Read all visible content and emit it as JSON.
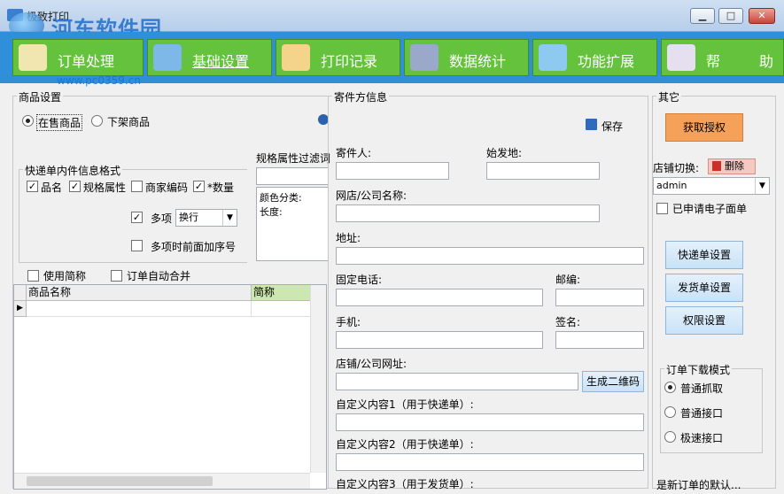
{
  "window": {
    "title": "极致打印"
  },
  "watermark": {
    "name": "河东软件园",
    "url": "www.pc0359.cn"
  },
  "toolbar": {
    "items": [
      {
        "label": "订单处理",
        "icon": "document-icon"
      },
      {
        "label": "基础设置",
        "icon": "gear-icon"
      },
      {
        "label": "打印记录",
        "icon": "printer-icon"
      },
      {
        "label": "数据统计",
        "icon": "bar-chart-icon"
      },
      {
        "label": "功能扩展",
        "icon": "toolbox-icon"
      },
      {
        "label": "帮",
        "icon": "help-icon"
      },
      {
        "label": "助",
        "icon": ""
      }
    ]
  },
  "product_settings": {
    "title": "商品设置",
    "radio_on_sale": "在售商品",
    "radio_off_sale": "下架商品",
    "spec_filter_label": "规格属性过滤词",
    "spec_filter_text": "颜色分类:\n长度:",
    "express_group_title": "快递单内件信息格式",
    "chk_name": "品名",
    "chk_spec": "规格属性",
    "chk_code": "商家编码",
    "chk_qty": "*数量",
    "multi_label": "多项",
    "multi_value": "换行",
    "multi_index_label": "多项时前面加序号",
    "use_short_label": "使用简称",
    "auto_merge_label": "订单自动合并",
    "grid_col_name": "商品名称",
    "grid_col_short": "简称"
  },
  "sender": {
    "title": "寄件方信息",
    "save_label": "保存",
    "sender_label": "寄件人:",
    "origin_label": "始发地:",
    "shop_label": "网店/公司名称:",
    "address_label": "地址:",
    "phone_label": "固定电话:",
    "zip_label": "邮编:",
    "mobile_label": "手机:",
    "sign_label": "签名:",
    "url_label": "店铺/公司网址:",
    "qr_label": "生成二维码",
    "custom1_label": "自定义内容1（用于快递单）:",
    "custom2_label": "自定义内容2（用于快递单）:",
    "custom3_label": "自定义内容3（用于发货单）:"
  },
  "other": {
    "title": "其它",
    "auth_label": "获取授权",
    "shop_switch_label": "店铺切换:",
    "delete_label": "删除",
    "shop_value": "admin",
    "ereceipt_label": "已申请电子面单",
    "express_setting_label": "快递单设置",
    "invoice_setting_label": "发货单设置",
    "permission_label": "权限设置",
    "download_mode_title": "订单下载模式",
    "mode_normal_grab": "普通抓取",
    "mode_normal_api": "普通接口",
    "mode_fast_api": "极速接口",
    "cut_label": "是新订单的默认..."
  }
}
